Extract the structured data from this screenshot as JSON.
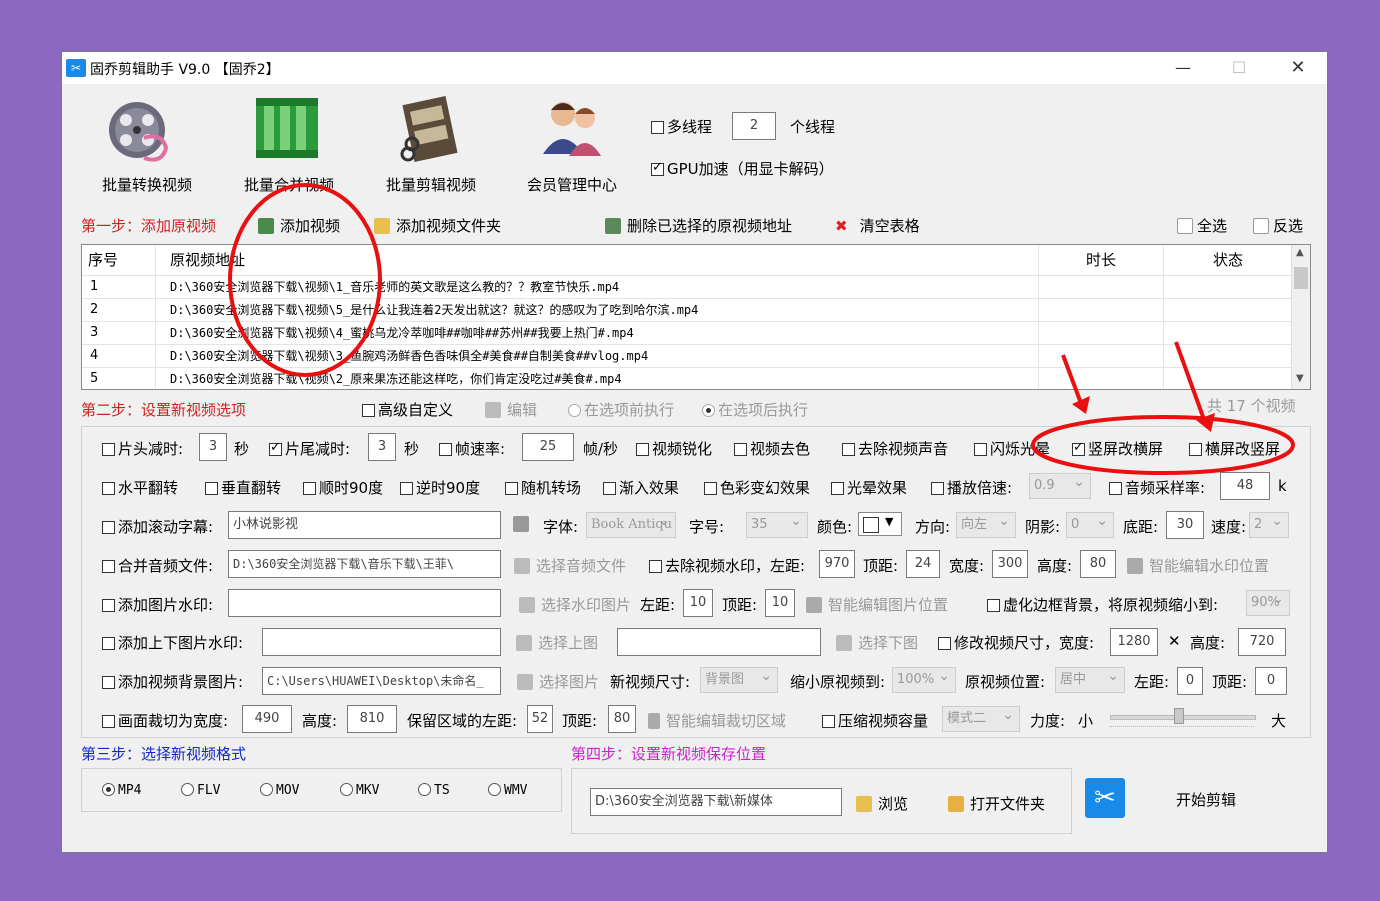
{
  "window": {
    "title": "固乔剪辑助手 V9.0 【固乔2】",
    "min": "—",
    "max": "☐",
    "close": "✕"
  },
  "toolbar": {
    "items": [
      {
        "label": "批量转换视频"
      },
      {
        "label": "批量合并视频"
      },
      {
        "label": "批量剪辑视频"
      },
      {
        "label": "会员管理中心"
      }
    ],
    "multithread_label": "多线程",
    "multithread_value": "2",
    "thread_unit": "个线程",
    "gpu_label": "GPU加速（用显卡解码）"
  },
  "step1": {
    "title": "第一步：添加原视频",
    "add_video": "添加视频",
    "add_folder": "添加视频文件夹",
    "delete_selected": "删除已选择的原视频地址",
    "clear_table": "清空表格",
    "select_all": "全选",
    "invert": "反选"
  },
  "table": {
    "headers": [
      "序号",
      "原视频地址",
      "时长",
      "状态"
    ],
    "rows": [
      {
        "n": "1",
        "path": "D:\\360安全浏览器下载\\视频\\1_音乐老师的英文歌是这么教的？？教室节快乐.mp4"
      },
      {
        "n": "2",
        "path": "D:\\360安全浏览器下载\\视频\\5_是什么让我连着2天发出就这？就这？的感叹为了吃到哈尔滨.mp4"
      },
      {
        "n": "3",
        "path": "D:\\360安全浏览器下载\\视频\\4_蜜桃乌龙冷萃咖啡##咖啡##苏州##我要上热门#.mp4"
      },
      {
        "n": "4",
        "path": "D:\\360安全浏览器下载\\视频\\3_鱼腕鸡汤鲜香色香味俱全#美食##自制美食##vlog.mp4"
      },
      {
        "n": "5",
        "path": "D:\\360安全浏览器下载\\视频\\2_原来果冻还能这样吃，你们肯定没吃过#美食#.mp4"
      }
    ],
    "count_text": "共 17 个视频"
  },
  "step2": {
    "title": "第二步：设置新视频选项",
    "advanced": "高级自定义",
    "edit": "编辑",
    "before": "在选项前执行",
    "after": "在选项后执行"
  },
  "opts": {
    "head_cut": "片头减时:",
    "head_val": "3",
    "sec": "秒",
    "tail_cut": "片尾减时:",
    "tail_val": "3",
    "sec2": "秒",
    "framerate": "帧速率:",
    "framerate_val": "25",
    "fps_unit": "帧/秒",
    "sharpen": "视频锐化",
    "decolor": "视频去色",
    "mute": "去除视频声音",
    "flash": "闪烁光晕",
    "v2h": "竖屏改横屏",
    "h2v": "横屏改竖屏",
    "hflip": "水平翻转",
    "vflip": "垂直翻转",
    "cw90": "顺时90度",
    "ccw90": "逆时90度",
    "rand_trans": "随机转场",
    "fade_in": "渐入效果",
    "color_fx": "色彩变幻效果",
    "halo": "光晕效果",
    "speed": "播放倍速:",
    "speed_val": "0.9",
    "sample": "音频采样率:",
    "sample_val": "48",
    "sample_unit": "k",
    "scroll_sub": "添加滚动字幕:",
    "scroll_text": "小林说影视",
    "font": "字体:",
    "font_val": "Book Antiqu",
    "size": "字号:",
    "size_val": "35",
    "color": "颜色:",
    "dir": "方向:",
    "dir_val": "向左",
    "shadow": "阴影:",
    "shadow_val": "0",
    "bottom": "底距:",
    "bottom_val": "30",
    "spd": "速度:",
    "spd_val": "2",
    "merge_audio": "合并音频文件:",
    "audio_path": "D:\\360安全浏览器下载\\音乐下载\\王菲\\",
    "select_audio": "选择音频文件",
    "rm_watermark": "去除视频水印，左距:",
    "wm_left": "970",
    "top": "顶距:",
    "wm_top": "24",
    "width": "宽度:",
    "wm_width": "300",
    "height": "高度:",
    "wm_height": "80",
    "smart_wm": "智能编辑水印位置",
    "img_wm": "添加图片水印:",
    "select_wm_img": "选择水印图片",
    "left": "左距:",
    "img_left": "10",
    "top2": "顶距:",
    "img_top": "10",
    "smart_img": "智能编辑图片位置",
    "blur_bg": "虚化边框背景，将原视频缩小到:",
    "blur_val": "90%",
    "tb_wm": "添加上下图片水印:",
    "select_top": "选择上图",
    "select_bottom": "选择下图",
    "resize": "修改视频尺寸，宽度:",
    "resize_w": "1280",
    "x": "✕",
    "height2": "高度:",
    "resize_h": "720",
    "bg_img": "添加视频背景图片:",
    "bg_path": "C:\\Users\\HUAWEI\\Desktop\\未命名_",
    "select_img": "选择图片",
    "new_size": "新视频尺寸:",
    "new_size_val": "背景图",
    "shrink": "缩小原视频到:",
    "shrink_val": "100%",
    "pos": "原视频位置:",
    "pos_val": "居中",
    "left2": "左距:",
    "left2_val": "0",
    "top3": "顶距:",
    "top3_val": "0",
    "crop": "画面裁切为宽度:",
    "crop_w": "490",
    "height3": "高度:",
    "crop_h": "810",
    "keep_left": "保留区域的左距:",
    "keep_left_val": "52",
    "top4": "顶距:",
    "keep_top_val": "80",
    "smart_crop": "智能编辑裁切区域",
    "compress": "压缩视频容量",
    "mode_val": "模式二",
    "strength": "力度:",
    "small": "小",
    "large": "大"
  },
  "step3": {
    "title": "第三步：选择新视频格式",
    "formats": [
      "MP4",
      "FLV",
      "MOV",
      "MKV",
      "TS",
      "WMV"
    ]
  },
  "step4": {
    "title": "第四步：设置新视频保存位置",
    "path": "D:\\360安全浏览器下载\\新媒体",
    "browse": "浏览",
    "open_folder": "打开文件夹",
    "start": "开始剪辑"
  },
  "colors": {
    "step_red": "#d42020",
    "step_blue": "#1428c8",
    "step_magenta": "#cc22cc",
    "annot_red": "#e81010"
  }
}
